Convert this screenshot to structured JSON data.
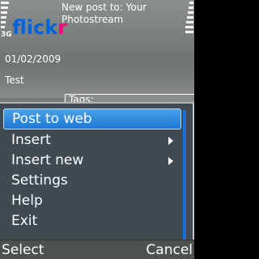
{
  "status": {
    "network": "3G"
  },
  "header": {
    "logo_part1": "flick",
    "logo_part2": "r",
    "title": "New post to: Your Photostream"
  },
  "form": {
    "date": "01/02/2009",
    "title_value": "Test",
    "tags_label": "Tags:"
  },
  "menu": {
    "items": [
      {
        "label": "Post to web",
        "selected": true,
        "has_submenu": false
      },
      {
        "label": "Insert",
        "selected": false,
        "has_submenu": true
      },
      {
        "label": "Insert new",
        "selected": false,
        "has_submenu": true
      },
      {
        "label": "Settings",
        "selected": false,
        "has_submenu": false
      },
      {
        "label": "Help",
        "selected": false,
        "has_submenu": false
      },
      {
        "label": "Exit",
        "selected": false,
        "has_submenu": false
      }
    ]
  },
  "softkeys": {
    "left": "Select",
    "right": "Cancel"
  },
  "colors": {
    "flickr_blue": "#0063dc",
    "flickr_pink": "#ff0084",
    "highlight": "#2a86dc",
    "menu_bg": "#3f4a52"
  }
}
